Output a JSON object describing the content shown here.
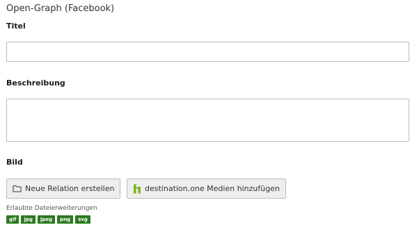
{
  "section": {
    "title": "Open-Graph (Facebook)"
  },
  "fields": {
    "title_label": "Titel",
    "title_value": "",
    "description_label": "Beschreibung",
    "description_value": "",
    "image_label": "Bild"
  },
  "buttons": {
    "new_relation": {
      "label": "Neue Relation erstellen",
      "icon": "folder-icon"
    },
    "destination_media": {
      "label": "destination.one Medien hinzufügen",
      "icon": "destination-one-logo-icon"
    }
  },
  "allowed": {
    "label": "Erlaubte Dateierweiterungen",
    "extensions": [
      "gif",
      "jpg",
      "jpeg",
      "png",
      "svg"
    ]
  },
  "colors": {
    "badge": "#2b7a1f",
    "logo_green": "#7ab317",
    "button_bg": "#eeeeee",
    "border": "#bbbbbb"
  }
}
